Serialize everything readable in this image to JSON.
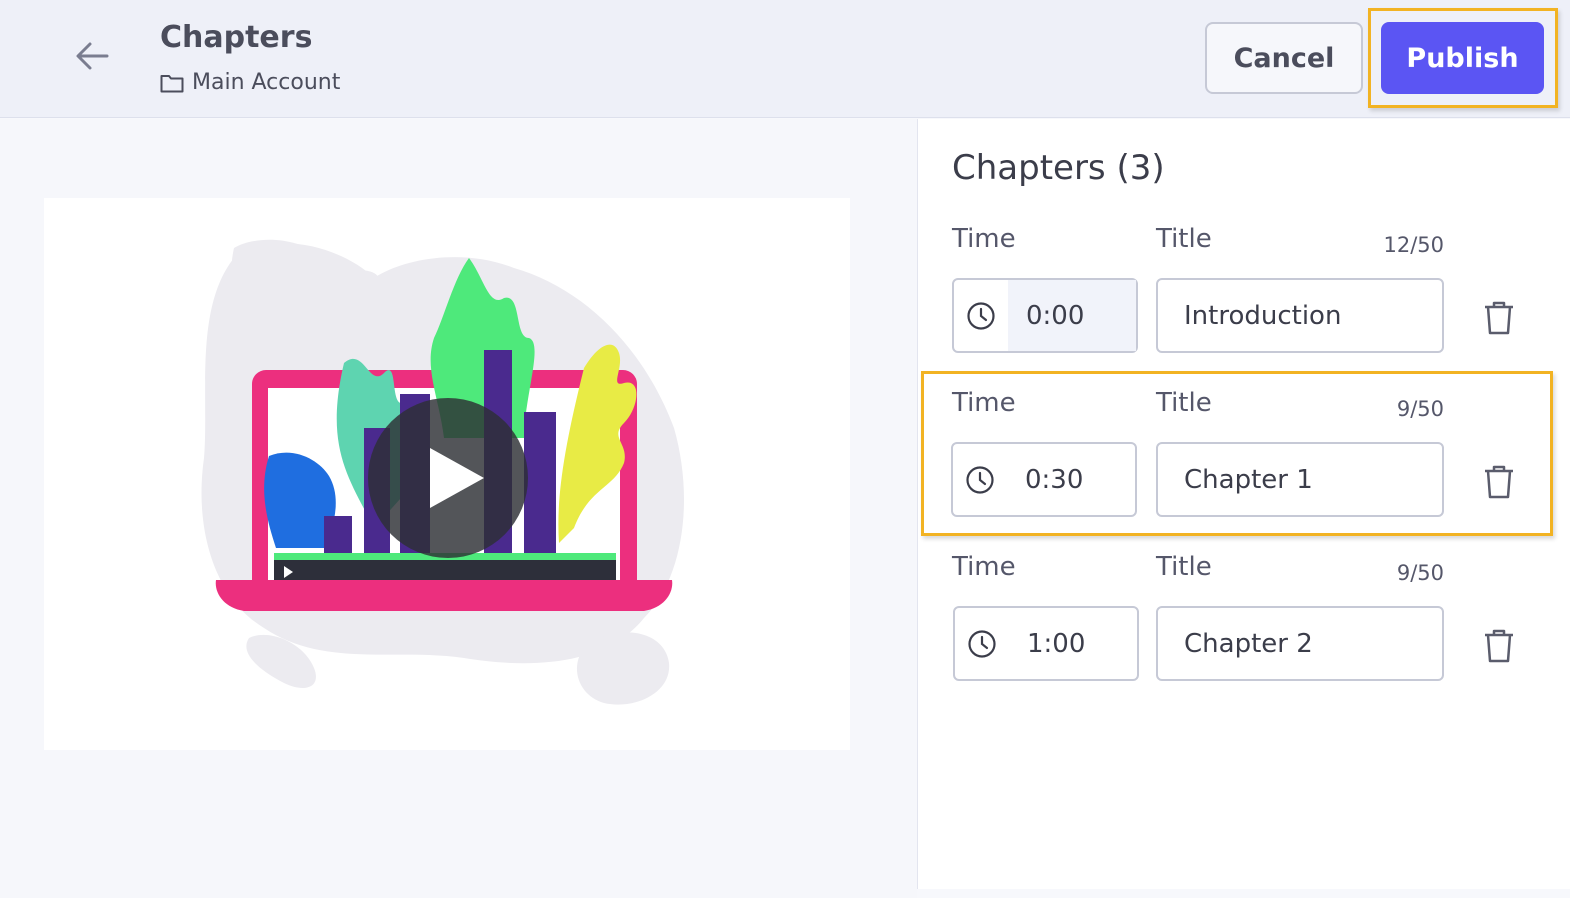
{
  "header": {
    "title": "Chapters",
    "breadcrumb": "Main Account",
    "cancel_label": "Cancel",
    "publish_label": "Publish"
  },
  "chapters_panel": {
    "heading": "Chapters (3)",
    "time_label": "Time",
    "title_label": "Title",
    "rows": [
      {
        "time": "0:00",
        "title": "Introduction",
        "count": "12/50"
      },
      {
        "time": "0:30",
        "title": "Chapter 1",
        "count": "9/50"
      },
      {
        "time": "1:00",
        "title": "Chapter 2",
        "count": "9/50"
      }
    ]
  },
  "icons": {
    "back": "arrow-left-icon",
    "folder": "folder-icon",
    "clock": "clock-icon",
    "delete": "trash-icon",
    "play": "play-icon"
  },
  "colors": {
    "accent": "#5b55f3",
    "highlight": "#f2b323"
  }
}
